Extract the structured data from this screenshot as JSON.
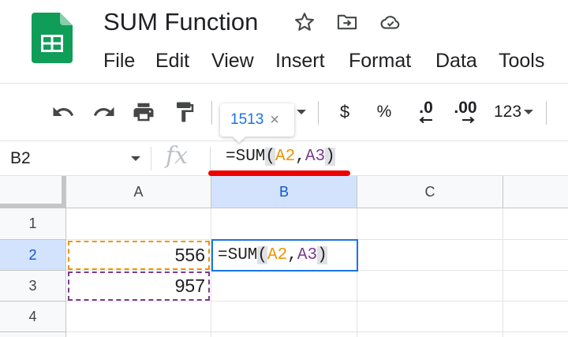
{
  "header": {
    "title": "SUM Function",
    "menu": [
      "File",
      "Edit",
      "View",
      "Insert",
      "Format",
      "Data",
      "Tools"
    ]
  },
  "toolbar": {
    "currency_label": "$",
    "percent_label": "%",
    "decrease_decimal_label": ".0",
    "increase_decimal_label": ".00",
    "number_format_label": "123"
  },
  "tooltip": {
    "value": "1513",
    "close_glyph": "×"
  },
  "formula_bar": {
    "name_box": "B2",
    "fx_label": "fx",
    "formula": {
      "prefix": "=SUM",
      "open_paren": "(",
      "ref1": "A2",
      "comma": ",",
      "ref2": "A3",
      "close_paren": ")"
    }
  },
  "grid": {
    "columns": [
      "A",
      "B",
      "C"
    ],
    "rows": [
      "1",
      "2",
      "3",
      "4"
    ],
    "cells": {
      "A2": "556",
      "A3": "957"
    },
    "active_cell": "B2"
  },
  "colors": {
    "ref1": "#f09300",
    "ref2": "#7c3a8e",
    "selection": "#1a73e8",
    "annotation_underline": "#ee0000",
    "sheets_green": "#0f9d58"
  },
  "icons": {
    "logo": "google-sheets-logo",
    "star": "star-icon",
    "move": "move-to-folder-icon",
    "cloud": "cloud-saved-icon",
    "undo": "undo-icon",
    "redo": "redo-icon",
    "print": "print-icon",
    "paint_format": "paint-format-icon"
  }
}
